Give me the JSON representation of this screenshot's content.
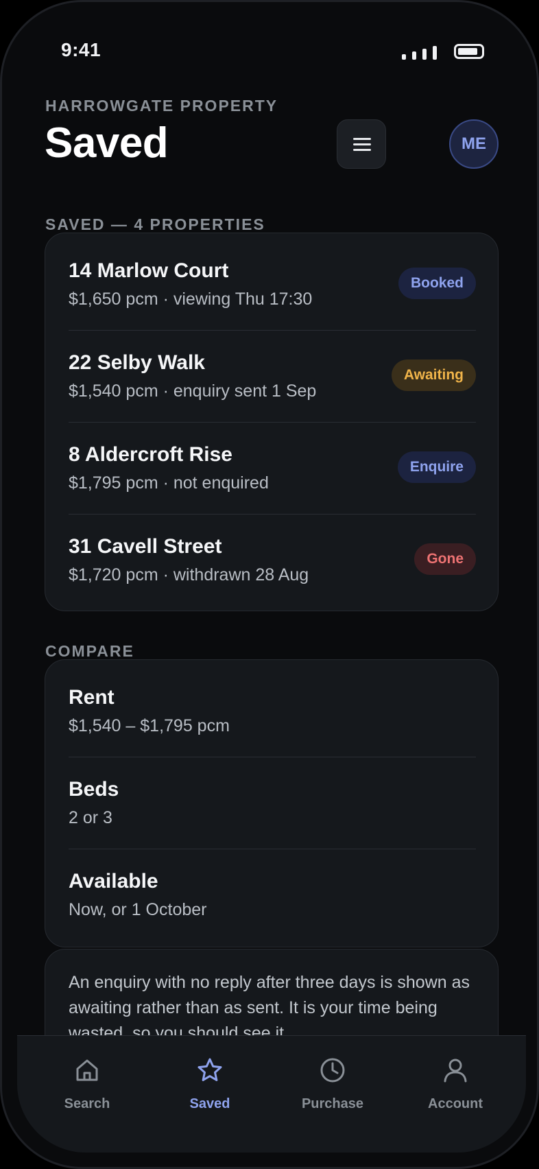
{
  "status_bar": {
    "time": "9:41"
  },
  "header": {
    "kicker": "HARROWGATE PROPERTY",
    "title": "Saved",
    "menu_icon": "hamburger-menu-icon",
    "avatar_initials": "ME"
  },
  "saved": {
    "section_label": "SAVED — 4 PROPERTIES",
    "items": [
      {
        "title": "14 Marlow Court",
        "subtitle": "$1,650 pcm · viewing Thu 17:30",
        "badge": "Booked",
        "badge_text_color": "#8fa3ee",
        "badge_bg_color": "#1c2340"
      },
      {
        "title": "22 Selby Walk",
        "subtitle": "$1,540 pcm · enquiry sent 1 Sep",
        "badge": "Awaiting",
        "badge_text_color": "#f0b44a",
        "badge_bg_color": "#3a2f1a"
      },
      {
        "title": "8 Aldercroft Rise",
        "subtitle": "$1,795 pcm · not enquired",
        "badge": "Enquire",
        "badge_text_color": "#8fa3ee",
        "badge_bg_color": "#1c2340"
      },
      {
        "title": "31 Cavell Street",
        "subtitle": "$1,720 pcm · withdrawn 28 Aug",
        "badge": "Gone",
        "badge_text_color": "#ee7373",
        "badge_bg_color": "#3a1e22"
      }
    ]
  },
  "compare": {
    "section_label": "COMPARE",
    "rows": [
      {
        "title": "Rent",
        "value": "$1,540 – $1,795 pcm"
      },
      {
        "title": "Beds",
        "value": "2 or 3"
      },
      {
        "title": "Available",
        "value": "Now, or 1 October"
      }
    ]
  },
  "note": {
    "text": "An enquiry with no reply after three days is shown as awaiting rather than as sent. It is your time being wasted, so you should see it."
  },
  "tab_bar": {
    "active_color": "#8fa3ee",
    "inactive_color": "#8a9097",
    "tabs": [
      {
        "label": "Search",
        "icon": "home-icon",
        "active": false
      },
      {
        "label": "Saved",
        "icon": "star-icon",
        "active": true
      },
      {
        "label": "Purchase",
        "icon": "clock-icon",
        "active": false
      },
      {
        "label": "Account",
        "icon": "person-icon",
        "active": false
      }
    ]
  }
}
